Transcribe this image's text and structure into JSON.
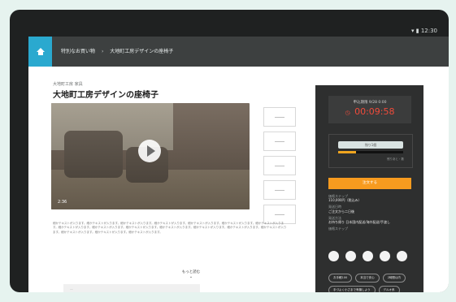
{
  "status": {
    "icons": [
      "wifi-icon",
      "battery-icon"
    ],
    "time": "12:30"
  },
  "breadcrumbs": [
    "特別なお買い物",
    "大地町工房デザインの座椅子"
  ],
  "page": {
    "category_line": "大地町工房 家具",
    "title": "大地町工房デザインの座椅子"
  },
  "media": {
    "video_time": "2:36",
    "thumbnail_count": 5
  },
  "description": "細かテキストが入ります。細かテキストが入ります。細かテキストが入ります。細かテキストが入ります。細かテキストが入ります。細かテキストが入ります。細かテキストが入ります。細かテキストが入ります。細かテキストが入ります。細かテキストが入ります。細かテキストが入ります。細かテキストが入ります。細かテキストが入ります。細かテキストが入ります。細かテキストが入ります。細かテキストが入ります。細かテキストが入ります。",
  "more": {
    "label": "もっと読む",
    "chevron": "⌄"
  },
  "sidebar": {
    "deadline_label": "申込期限 9/28 0:00",
    "countdown": "00:09:58",
    "progress_button": "残り1個",
    "progress_value": 0.28,
    "progress_text": "残りあと・数",
    "action_button": "注文する",
    "info": [
      {
        "label": "価格ステップ",
        "value": "110,000円（税込み）"
      },
      {
        "label": "発送日時",
        "value": "ご注文から二日後"
      },
      {
        "label": "発送方法",
        "value": "お持ち帰り 日本国内配送/海外配送/手渡し"
      }
    ],
    "swatches_label": "価格ステップ",
    "tags": [
      "お手軽100",
      "本当で安心",
      "2時間以内",
      "手づよく小さまで有機しよう",
      "デルオ系"
    ]
  },
  "colors": {
    "top_bar": "#3d4040",
    "accent_blue": "#2aa9cf",
    "sidebar": "#2e2f2f",
    "timer": "#f04b3b",
    "action": "#f79b1f",
    "progress": "#f0a51f"
  }
}
